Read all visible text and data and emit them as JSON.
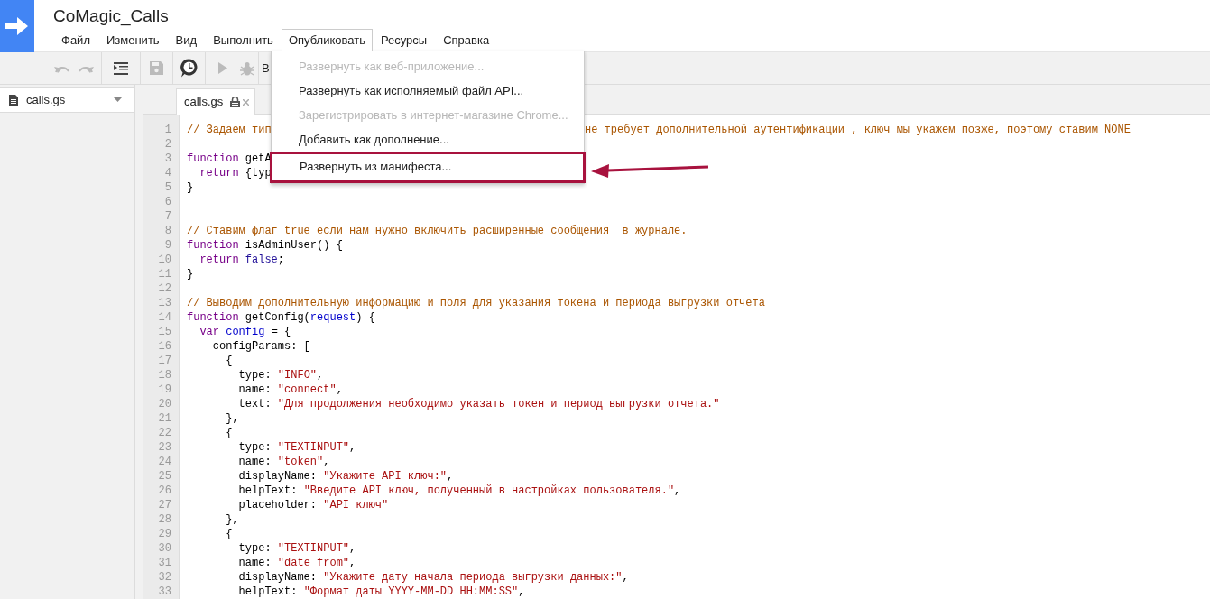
{
  "project": {
    "title": "CoMagic_Calls"
  },
  "menubar": [
    {
      "label": "Файл",
      "open": false
    },
    {
      "label": "Изменить",
      "open": false
    },
    {
      "label": "Вид",
      "open": false
    },
    {
      "label": "Выполнить",
      "open": false
    },
    {
      "label": "Опубликовать",
      "open": true
    },
    {
      "label": "Ресурсы",
      "open": false
    },
    {
      "label": "Справка",
      "open": false
    }
  ],
  "toolbar": {
    "function_select": "В"
  },
  "publish_menu": [
    {
      "label": "Развернуть как веб-приложение...",
      "disabled": true,
      "marked": false
    },
    {
      "label": "Развернуть как исполняемый файл API...",
      "disabled": false,
      "marked": false
    },
    {
      "label": "Зарегистрировать в интернет-магазине Chrome...",
      "disabled": true,
      "marked": false
    },
    {
      "label": "Добавить как дополнение...",
      "disabled": false,
      "marked": false
    },
    {
      "label": "Развернуть из манифеста...",
      "disabled": false,
      "marked": true
    }
  ],
  "sidebar": {
    "files": [
      {
        "name": "calls.gs",
        "selected": true
      }
    ]
  },
  "tabs": [
    {
      "label": "calls.gs",
      "selected": true
    }
  ],
  "code": [
    {
      "n": "1",
      "tokens": [
        {
          "kind": "comment",
          "text": "// Задаем тип"
        }
      ],
      "after_menu": [
        {
          "kind": "comment",
          "text": "не требует дополнительной аутентификации , ключ мы укажем позже, поэтому ставим NONE"
        }
      ]
    },
    {
      "n": "2"
    },
    {
      "n": "3",
      "tokens": [
        {
          "kind": "keyword",
          "text": "function"
        },
        {
          "kind": "plain",
          "text": " getA"
        }
      ]
    },
    {
      "n": "4",
      "tokens": [
        {
          "kind": "keyword",
          "text": "  return"
        },
        {
          "kind": "plain",
          "text": " {typ"
        }
      ]
    },
    {
      "n": "5",
      "tokens": [
        {
          "kind": "plain",
          "text": "}"
        }
      ]
    },
    {
      "n": "6"
    },
    {
      "n": "7"
    },
    {
      "n": "8",
      "tokens": [
        {
          "kind": "comment",
          "text": "// Ставим флаг true если нам нужно включить расширенные сообщения  в журнале."
        }
      ]
    },
    {
      "n": "9",
      "tokens": [
        {
          "kind": "keyword",
          "text": "function"
        },
        {
          "kind": "plain",
          "text": " isAdminUser() {"
        }
      ]
    },
    {
      "n": "10",
      "tokens": [
        {
          "kind": "keyword",
          "text": "  return"
        },
        {
          "kind": "atom",
          "text": " false"
        },
        {
          "kind": "plain",
          "text": ";"
        }
      ]
    },
    {
      "n": "11",
      "tokens": [
        {
          "kind": "plain",
          "text": "}"
        }
      ]
    },
    {
      "n": "12"
    },
    {
      "n": "13",
      "tokens": [
        {
          "kind": "comment",
          "text": "// Выводим дополнительную информацию и поля для указания токена и периода выгрузки отчета"
        }
      ]
    },
    {
      "n": "14",
      "tokens": [
        {
          "kind": "keyword",
          "text": "function"
        },
        {
          "kind": "plain",
          "text": " getConfig("
        },
        {
          "kind": "variable",
          "text": "request"
        },
        {
          "kind": "plain",
          "text": ") {"
        }
      ]
    },
    {
      "n": "15",
      "tokens": [
        {
          "kind": "keyword",
          "text": "  var"
        },
        {
          "kind": "variable",
          "text": " config"
        },
        {
          "kind": "plain",
          "text": " = {"
        }
      ]
    },
    {
      "n": "16",
      "tokens": [
        {
          "kind": "plain",
          "text": "    configParams: ["
        }
      ]
    },
    {
      "n": "17",
      "tokens": [
        {
          "kind": "plain",
          "text": "      {"
        }
      ]
    },
    {
      "n": "18",
      "tokens": [
        {
          "kind": "plain",
          "text": "        type: "
        },
        {
          "kind": "string",
          "text": "\"INFO\""
        },
        {
          "kind": "plain",
          "text": ","
        }
      ]
    },
    {
      "n": "19",
      "tokens": [
        {
          "kind": "plain",
          "text": "        name: "
        },
        {
          "kind": "string",
          "text": "\"connect\""
        },
        {
          "kind": "plain",
          "text": ","
        }
      ]
    },
    {
      "n": "20",
      "tokens": [
        {
          "kind": "plain",
          "text": "        text: "
        },
        {
          "kind": "string",
          "text": "\"Для продолжения необходимо указать токен и период выгрузки отчета.\""
        }
      ]
    },
    {
      "n": "21",
      "tokens": [
        {
          "kind": "plain",
          "text": "      },"
        }
      ]
    },
    {
      "n": "22",
      "tokens": [
        {
          "kind": "plain",
          "text": "      {"
        }
      ]
    },
    {
      "n": "23",
      "tokens": [
        {
          "kind": "plain",
          "text": "        type: "
        },
        {
          "kind": "string",
          "text": "\"TEXTINPUT\""
        },
        {
          "kind": "plain",
          "text": ","
        }
      ]
    },
    {
      "n": "24",
      "tokens": [
        {
          "kind": "plain",
          "text": "        name: "
        },
        {
          "kind": "string",
          "text": "\"token\""
        },
        {
          "kind": "plain",
          "text": ","
        }
      ]
    },
    {
      "n": "25",
      "tokens": [
        {
          "kind": "plain",
          "text": "        displayName: "
        },
        {
          "kind": "string",
          "text": "\"Укажите API ключ:\""
        },
        {
          "kind": "plain",
          "text": ","
        }
      ]
    },
    {
      "n": "26",
      "tokens": [
        {
          "kind": "plain",
          "text": "        helpText: "
        },
        {
          "kind": "string",
          "text": "\"Введите API ключ, полученный в настройках пользователя.\""
        },
        {
          "kind": "plain",
          "text": ","
        }
      ]
    },
    {
      "n": "27",
      "tokens": [
        {
          "kind": "plain",
          "text": "        placeholder: "
        },
        {
          "kind": "string",
          "text": "\"API ключ\""
        }
      ]
    },
    {
      "n": "28",
      "tokens": [
        {
          "kind": "plain",
          "text": "      },"
        }
      ]
    },
    {
      "n": "29",
      "tokens": [
        {
          "kind": "plain",
          "text": "      {"
        }
      ]
    },
    {
      "n": "30",
      "tokens": [
        {
          "kind": "plain",
          "text": "        type: "
        },
        {
          "kind": "string",
          "text": "\"TEXTINPUT\""
        },
        {
          "kind": "plain",
          "text": ","
        }
      ]
    },
    {
      "n": "31",
      "tokens": [
        {
          "kind": "plain",
          "text": "        name: "
        },
        {
          "kind": "string",
          "text": "\"date_from\""
        },
        {
          "kind": "plain",
          "text": ","
        }
      ]
    },
    {
      "n": "32",
      "tokens": [
        {
          "kind": "plain",
          "text": "        displayName: "
        },
        {
          "kind": "string",
          "text": "\"Укажите дату начала периода выгрузки данных:\""
        },
        {
          "kind": "plain",
          "text": ","
        }
      ]
    },
    {
      "n": "33",
      "tokens": [
        {
          "kind": "plain",
          "text": "        helpText: "
        },
        {
          "kind": "string",
          "text": "\"Формат даты YYYY-MM-DD HH:MM:SS\""
        },
        {
          "kind": "plain",
          "text": ","
        }
      ]
    }
  ]
}
